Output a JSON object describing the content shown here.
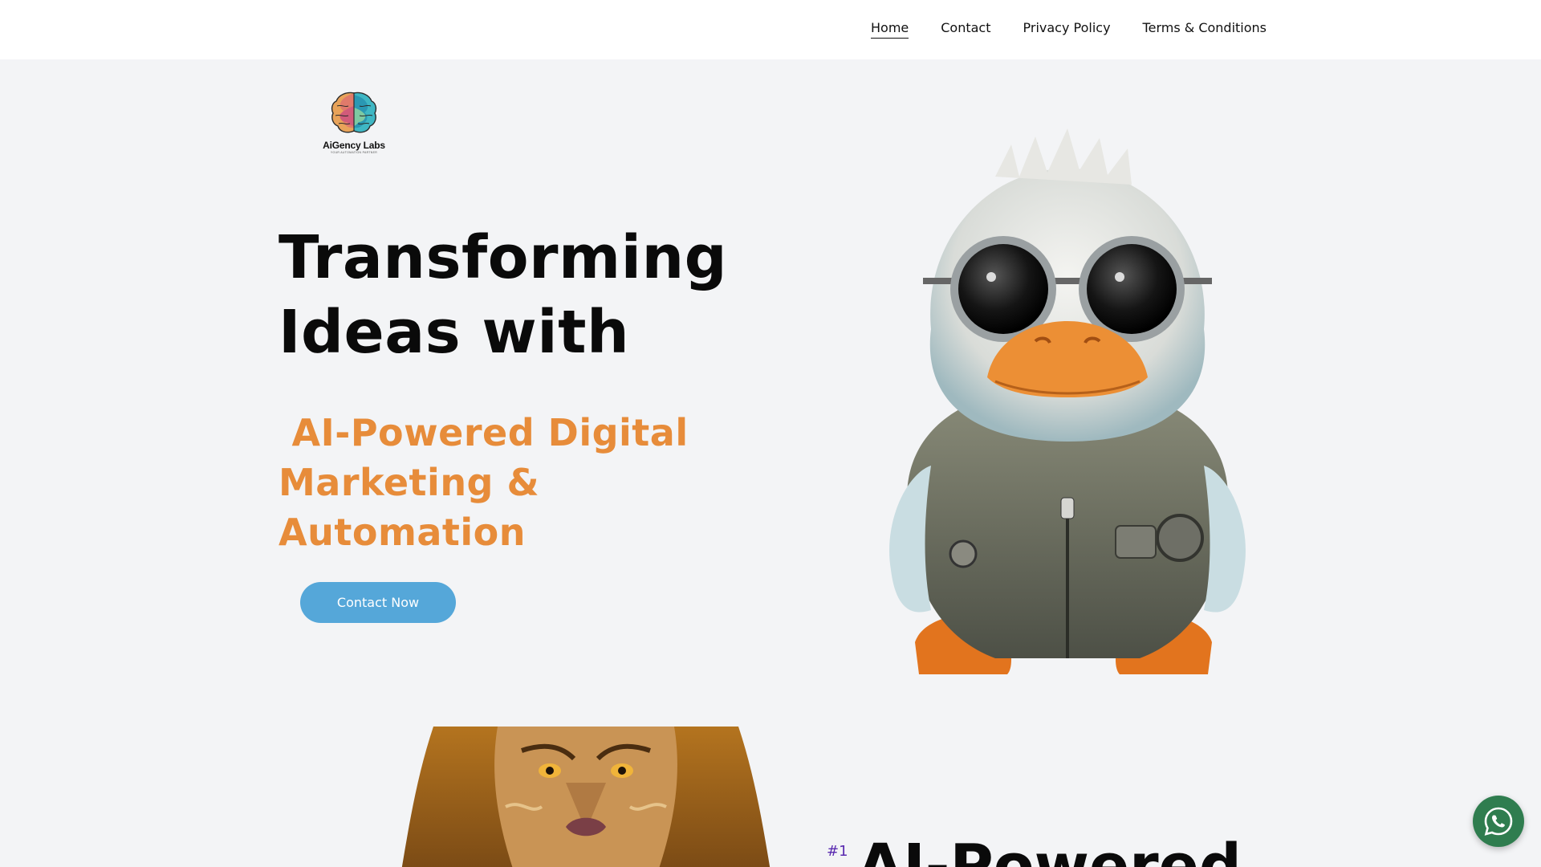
{
  "nav": {
    "items": [
      {
        "label": "Home",
        "active": true
      },
      {
        "label": "Contact",
        "active": false
      },
      {
        "label": "Privacy Policy",
        "active": false
      },
      {
        "label": "Terms & Conditions",
        "active": false
      }
    ]
  },
  "logo": {
    "name": "AiGency Labs",
    "tagline": "YOUR AUTOMATION PARTNER"
  },
  "hero": {
    "title_line1": "Transforming",
    "title_line2": "Ideas with",
    "subtitle": " AI-Powered Digital Marketing & Automation",
    "cta_label": "Contact Now"
  },
  "section2": {
    "rank": "#1",
    "title": "AI-Powered"
  },
  "colors": {
    "accent_orange": "#e78c3a",
    "button_blue": "#55a7d9",
    "whatsapp_green": "#2f7d4f",
    "rank_purple": "#5a2bb0"
  },
  "icons": {
    "whatsapp": "whatsapp-icon",
    "logo": "brain-icon"
  }
}
